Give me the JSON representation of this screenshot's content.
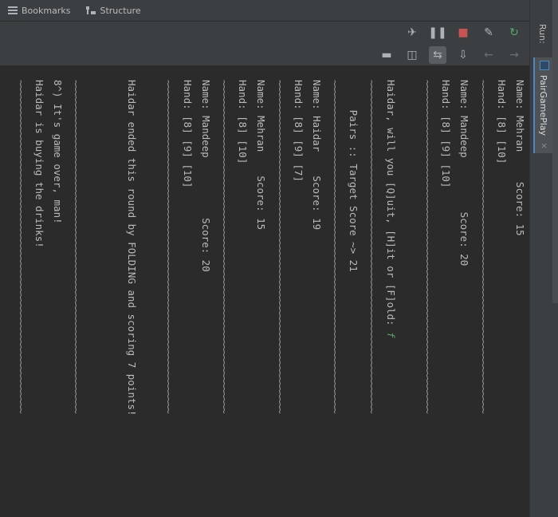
{
  "top_tabs": [
    "Bookmarks",
    "Structure"
  ],
  "right_bar": {
    "run_label": "Run:",
    "tab_label": "PairGamePlay",
    "tab_close": "×"
  },
  "toolbar1": {
    "icons": [
      "pin-icon",
      "pause-icon",
      "stop-icon",
      "wrench-icon",
      "rerun-icon"
    ]
  },
  "toolbar2": {
    "icons": [
      "exit-icon",
      "layout-icon",
      "soft-wrap-icon",
      "scroll-to-end-icon",
      "back-arrow-icon",
      "forward-arrow-icon"
    ]
  },
  "console": {
    "lines": [
      "Name: Mehran     Score: 15",
      "Hand: [8] [10]",
      "~~~~~~~~~~~~~~~~~~~~~~~~~~~~~~~~~~~~~~~~~~~~~~~~~~~~~~~~~~~~~~~~",
      "Name: Mandeep         Score: 20",
      "Hand: [8] [9] [10]",
      "~~~~~~~~~~~~~~~~~~~~~~~~~~~~~~~~~~~~~~~~~~~~~~~~~~~~~~~~~~~~~~~~",
      "",
      "Haidar, will you [Q]uit, [H]it or [F]old: ",
      "~~~~~~~~~~~~~~~~~~~~~~~~~~~~~~~~~~~~~~~~~~~~~~~~~~~~~~~~~~~~~~~~",
      "     Pairs :: Target Score ~> 21",
      "~~~~~~~~~~~~~~~~~~~~~~~~~~~~~~~~~~~~~~~~~~~~~~~~~~~~~~~~~~~~~~~~",
      "Name: Haidar    Score: 19",
      "Hand: [8] [9] [7]",
      "~~~~~~~~~~~~~~~~~~~~~~~~~~~~~~~~~~~~~~~~~~~~~~~~~~~~~~~~~~~~~~~~",
      "Name: Mehran    Score: 15",
      "Hand: [8] [10]",
      "~~~~~~~~~~~~~~~~~~~~~~~~~~~~~~~~~~~~~~~~~~~~~~~~~~~~~~~~~~~~~~~~",
      "Name: Mandeep          Score: 20",
      "Hand: [8] [9] [10]",
      "~~~~~~~~~~~~~~~~~~~~~~~~~~~~~~~~~~~~~~~~~~~~~~~~~~~~~~~~~~~~~~~~",
      "",
      "Haidar ended this round by FOLDING and scoring 7 points!",
      "",
      "",
      "~~~~~~~~~~~~~~~~~~~~~~~~~~~~~~~~~~~~~~~~~~~~~~~~~~~~~~~~~~~~~~~~",
      "8^) It's game over, man!",
      "Haidar is buying the drinks!",
      "~~~~~~~~~~~~~~~~~~~~~~~~~~~~~~~~~~~~~~~~~~~~~~~~~~~~~~~~~~~~~~~~"
    ],
    "user_input": "f"
  }
}
